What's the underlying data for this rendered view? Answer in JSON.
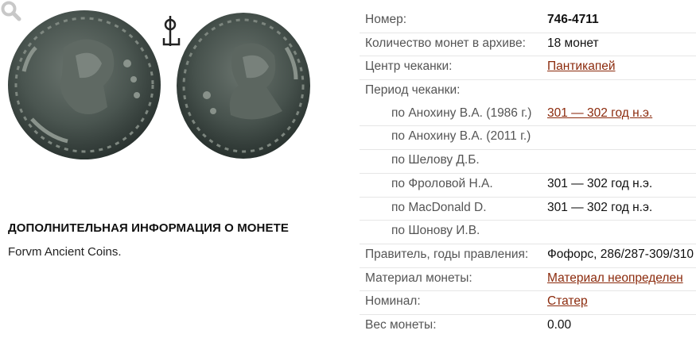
{
  "coin": {
    "icons": [
      "coin-obverse-image",
      "coin-reverse-image",
      "tamga-icon",
      "zoom-icon"
    ]
  },
  "extra_info": {
    "heading": "ДОПОЛНИТЕЛЬНАЯ ИНФОРМАЦИЯ О МОНЕТЕ",
    "text": "Forvm Ancient Coins."
  },
  "details": {
    "number_label": "Номер:",
    "number_value": "746-4711",
    "count_label": "Количество монет в архиве:",
    "count_value": "18 монет",
    "mint_label": "Центр чеканки:",
    "mint_value": "Пантикапей",
    "period_label": "Период чеканки:",
    "periods": [
      {
        "label": "по Анохину В.А. (1986 г.)",
        "value": "301 — 302 год н.э.",
        "link": true
      },
      {
        "label": "по Анохину В.А. (2011 г.)",
        "value": "",
        "link": false
      },
      {
        "label": "по Шелову Д.Б.",
        "value": "",
        "link": false
      },
      {
        "label": "по Фроловой Н.А.",
        "value": "301 — 302 год н.э.",
        "link": false
      },
      {
        "label": "по MacDonald D.",
        "value": "301 — 302 год н.э.",
        "link": false
      },
      {
        "label": "по Шонову И.В.",
        "value": "",
        "link": false
      }
    ],
    "ruler_label": "Правитель, годы правления:",
    "ruler_value": "Фофорс, 286/287-309/310",
    "material_label": "Материал монеты:",
    "material_value": "Материал неопределен",
    "denomination_label": "Номинал:",
    "denomination_value": "Статер",
    "weight_label": "Вес монеты:",
    "weight_value": "0.00"
  },
  "colors": {
    "link": "#8b2a0c",
    "coin_dark": "#2f3a36",
    "coin_mid": "#56605a"
  }
}
